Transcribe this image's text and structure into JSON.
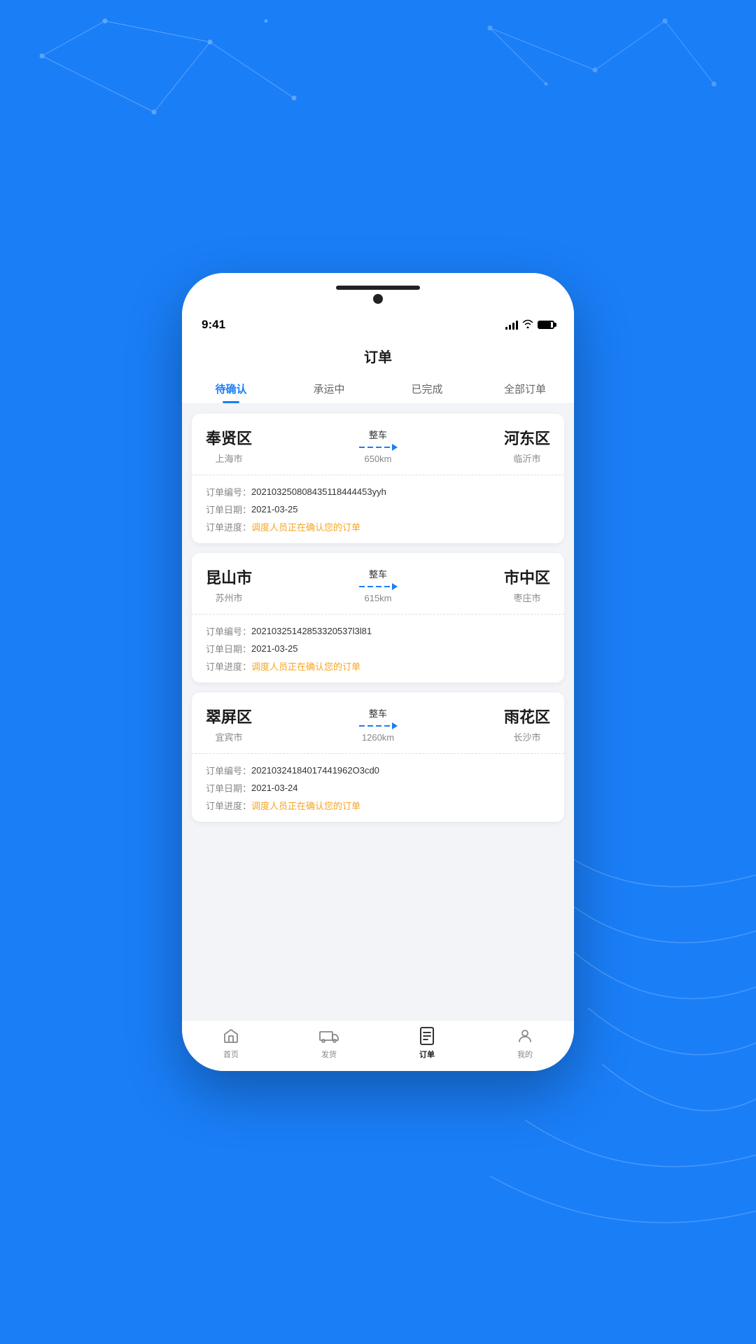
{
  "background": {
    "color": "#1a7ef7"
  },
  "status_bar": {
    "time": "9:41"
  },
  "page": {
    "title": "订单"
  },
  "tabs": [
    {
      "id": "pending",
      "label": "待确认",
      "active": true
    },
    {
      "id": "in_transit",
      "label": "承运中",
      "active": false
    },
    {
      "id": "completed",
      "label": "已完成",
      "active": false
    },
    {
      "id": "all",
      "label": "全部订单",
      "active": false
    }
  ],
  "orders": [
    {
      "from_city": "奉贤区",
      "from_parent": "上海市",
      "route_type": "整车",
      "distance": "650km",
      "to_city": "河东区",
      "to_parent": "临沂市",
      "order_no_label": "订单编号：",
      "order_no": "202103250808435118444453yyh",
      "order_date_label": "订单日期：",
      "order_date": "2021-03-25",
      "order_progress_label": "订单进度：",
      "order_progress": "调度人员正在确认您的订单"
    },
    {
      "from_city": "昆山市",
      "from_parent": "苏州市",
      "route_type": "整车",
      "distance": "615km",
      "to_city": "市中区",
      "to_parent": "枣庄市",
      "order_no_label": "订单编号：",
      "order_no": "20210325142853320537l3l81",
      "order_date_label": "订单日期：",
      "order_date": "2021-03-25",
      "order_progress_label": "订单进度：",
      "order_progress": "调度人员正在确认您的订单"
    },
    {
      "from_city": "翠屏区",
      "from_parent": "宜宾市",
      "route_type": "整车",
      "distance": "1260km",
      "to_city": "雨花区",
      "to_parent": "长沙市",
      "order_no_label": "订单编号：",
      "order_no": "20210324184017441962O3cd0",
      "order_date_label": "订单日期：",
      "order_date": "2021-03-24",
      "order_progress_label": "订单进度：",
      "order_progress": "调度人员正在确认您的订单"
    }
  ],
  "bottom_nav": [
    {
      "id": "home",
      "label": "首页",
      "active": false
    },
    {
      "id": "ship",
      "label": "发货",
      "active": false
    },
    {
      "id": "order",
      "label": "订单",
      "active": true
    },
    {
      "id": "mine",
      "label": "我的",
      "active": false
    }
  ]
}
